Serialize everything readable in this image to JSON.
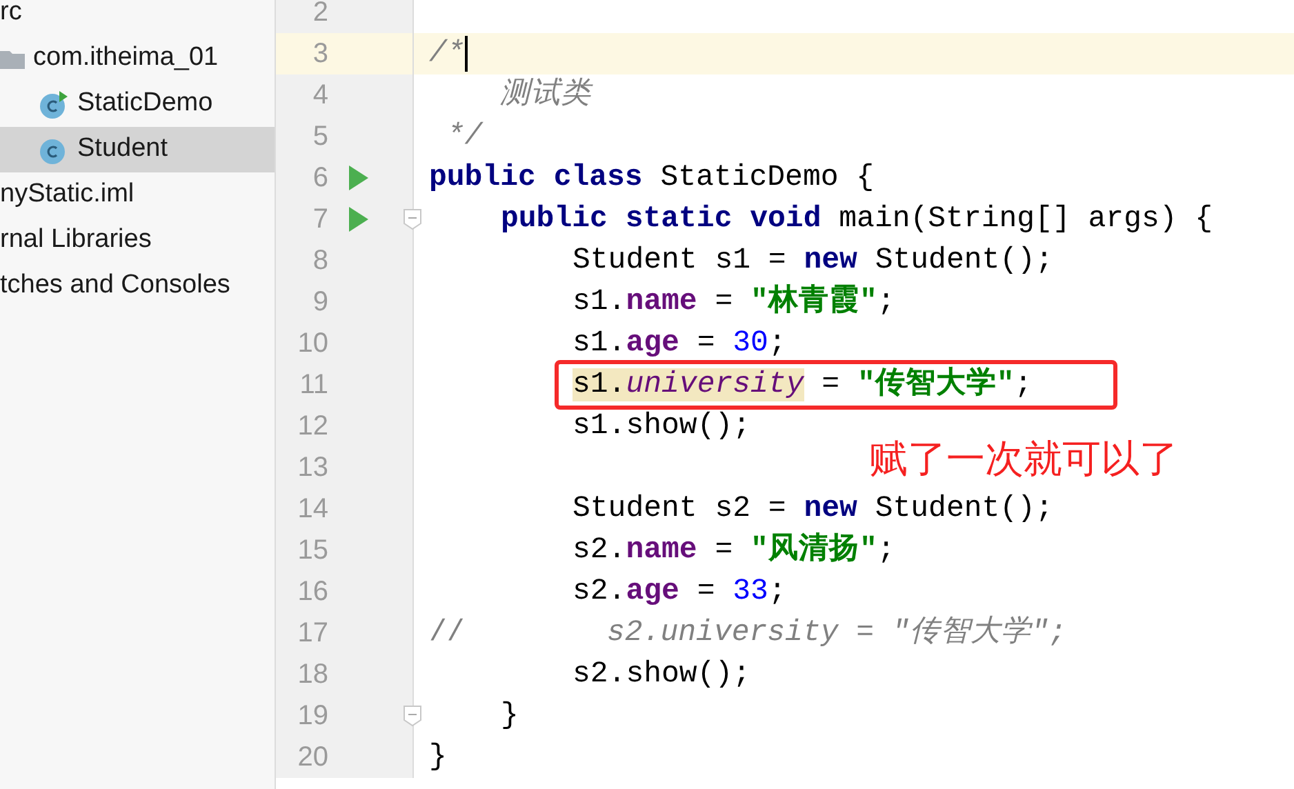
{
  "project_tree": [
    {
      "label": "rc",
      "selected": false,
      "children": [
        {
          "label": "com.itheima_01",
          "kind": "folder",
          "selected": false,
          "children": [
            {
              "label": "StaticDemo",
              "kind": "class-run",
              "selected": false
            },
            {
              "label": "Student",
              "kind": "class",
              "selected": true
            }
          ]
        }
      ]
    },
    {
      "label": "nyStatic.iml",
      "selected": false
    },
    {
      "label": "rnal Libraries",
      "selected": false
    },
    {
      "label": "tches and Consoles",
      "selected": false
    }
  ],
  "editor": {
    "lines": [
      {
        "number": "2",
        "kind": "top",
        "current": false
      },
      {
        "number": "3",
        "kind": "top",
        "current": true,
        "caret": true,
        "tokens": [
          {
            "kind": "comment",
            "text": "/*"
          }
        ]
      },
      {
        "number": "4",
        "kind": "top",
        "current": false,
        "tokens": [
          {
            "kind": "comment",
            "text": "    测试类"
          }
        ]
      },
      {
        "number": "5",
        "kind": "top",
        "current": false,
        "tokens": [
          {
            "kind": "comment",
            "text": " */"
          }
        ]
      },
      {
        "number": "6",
        "kind": "top",
        "current": false,
        "run": true,
        "tokens": [
          {
            "kind": "keyword",
            "text": "public class "
          },
          {
            "kind": "plain",
            "text": "StaticDemo {"
          }
        ]
      },
      {
        "number": "7",
        "kind": "method",
        "current": false,
        "run": true,
        "fold": true,
        "tokens": [
          {
            "kind": "keyword",
            "text": "public static void "
          },
          {
            "kind": "plain",
            "text": "main(String[] args) {"
          }
        ]
      },
      {
        "number": "8",
        "kind": "body",
        "current": false,
        "tokens": [
          {
            "kind": "plain",
            "text": "Student s1 = "
          },
          {
            "kind": "keyword",
            "text": "new "
          },
          {
            "kind": "plain",
            "text": "Student();"
          }
        ]
      },
      {
        "number": "9",
        "kind": "body",
        "current": false,
        "tokens": [
          {
            "kind": "plain",
            "text": "s1."
          },
          {
            "kind": "field",
            "text": "name"
          },
          {
            "kind": "plain",
            "text": " = "
          },
          {
            "kind": "string",
            "text": "\"林青霞\""
          },
          {
            "kind": "plain",
            "text": ";"
          }
        ]
      },
      {
        "number": "10",
        "kind": "body",
        "current": false,
        "tokens": [
          {
            "kind": "plain",
            "text": "s1."
          },
          {
            "kind": "field",
            "text": "age"
          },
          {
            "kind": "plain",
            "text": " = "
          },
          {
            "kind": "number",
            "text": "30"
          },
          {
            "kind": "plain",
            "text": ";"
          }
        ]
      },
      {
        "number": "11",
        "kind": "body",
        "current": false,
        "boxed": true,
        "tokens": [
          {
            "kind": "usage",
            "text": "s1."
          },
          {
            "kind": "usage-static",
            "text": "university"
          },
          {
            "kind": "plain",
            "text": " = "
          },
          {
            "kind": "string",
            "text": "\"传智大学\""
          },
          {
            "kind": "plain",
            "text": ";"
          }
        ]
      },
      {
        "number": "12",
        "kind": "body",
        "current": false,
        "tokens": [
          {
            "kind": "plain",
            "text": "s1.show();"
          }
        ]
      },
      {
        "number": "13",
        "kind": "body",
        "current": false
      },
      {
        "number": "14",
        "kind": "body",
        "current": false,
        "tokens": [
          {
            "kind": "plain",
            "text": "Student s2 = "
          },
          {
            "kind": "keyword",
            "text": "new "
          },
          {
            "kind": "plain",
            "text": "Student();"
          }
        ]
      },
      {
        "number": "15",
        "kind": "body",
        "current": false,
        "tokens": [
          {
            "kind": "plain",
            "text": "s2."
          },
          {
            "kind": "field",
            "text": "name"
          },
          {
            "kind": "plain",
            "text": " = "
          },
          {
            "kind": "string",
            "text": "\"风清扬\""
          },
          {
            "kind": "plain",
            "text": ";"
          }
        ]
      },
      {
        "number": "16",
        "kind": "body",
        "current": false,
        "tokens": [
          {
            "kind": "plain",
            "text": "s2."
          },
          {
            "kind": "field",
            "text": "age"
          },
          {
            "kind": "plain",
            "text": " = "
          },
          {
            "kind": "number",
            "text": "33"
          },
          {
            "kind": "plain",
            "text": ";"
          }
        ]
      },
      {
        "number": "17",
        "kind": "top",
        "current": false,
        "tokens": [
          {
            "kind": "comment-marker",
            "text": "//"
          },
          {
            "kind": "comment",
            "text": "        s2.university = \"传智大学\";"
          }
        ]
      },
      {
        "number": "18",
        "kind": "body",
        "current": false,
        "tokens": [
          {
            "kind": "plain",
            "text": "s2.show();"
          }
        ]
      },
      {
        "number": "19",
        "kind": "method",
        "current": false,
        "fold": true,
        "tokens": [
          {
            "kind": "plain",
            "text": "}"
          }
        ]
      },
      {
        "number": "20",
        "kind": "top",
        "current": false,
        "tokens": [
          {
            "kind": "plain",
            "text": "}"
          }
        ]
      }
    ]
  },
  "annotation": {
    "text": "赋了一次就可以了"
  }
}
